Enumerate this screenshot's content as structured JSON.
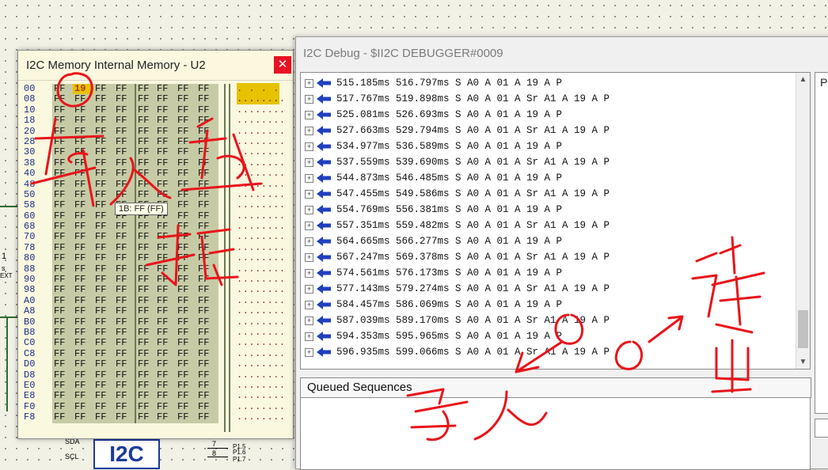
{
  "schematic": {
    "logo": "I2C",
    "pins": [
      {
        "num": "7",
        "label": "P1.5"
      },
      {
        "num": "8",
        "label": "P1.6"
      },
      {
        "num": "",
        "label": "P1.7"
      }
    ],
    "net_labels": [
      "SDA",
      "SCL"
    ],
    "left_labels": [
      "1",
      "s",
      "EXT"
    ],
    "wire_color": "#2f6b2f"
  },
  "memory_window": {
    "title": "I2C Memory Internal Memory - U2",
    "close_glyph": "✕",
    "addresses": [
      "00",
      "08",
      "10",
      "18",
      "20",
      "28",
      "30",
      "38",
      "40",
      "48",
      "50",
      "58",
      "60",
      "68",
      "70",
      "78",
      "80",
      "88",
      "90",
      "98",
      "A0",
      "A8",
      "B0",
      "B8",
      "C0",
      "C8",
      "D0",
      "D8",
      "E0",
      "E8",
      "F0",
      "F8"
    ],
    "fill_byte": "FF",
    "first_row": [
      "FF",
      "19",
      "FF",
      "FF",
      "FF",
      "FF",
      "FF",
      "FF"
    ],
    "highlight_value": "19",
    "ascii_first_row": ". . . . . . . .",
    "ascii_row": "........",
    "tooltip": "1B: FF (FF)"
  },
  "debug_window": {
    "title": "I2C Debug - $II2C DEBUGGER#0009",
    "expander_glyph": "+",
    "rows": [
      "515.185ms 516.797ms S A0 A 01 A 19 A P",
      "517.767ms 519.898ms S A0 A 01 A Sr A1 A 19 A P",
      "525.081ms 526.693ms S A0 A 01 A 19 A P",
      "527.663ms 529.794ms S A0 A 01 A Sr A1 A 19 A P",
      "534.977ms 536.589ms S A0 A 01 A 19 A P",
      "537.559ms 539.690ms S A0 A 01 A Sr A1 A 19 A P",
      "544.873ms 546.485ms S A0 A 01 A 19 A P",
      "547.455ms 549.586ms S A0 A 01 A Sr A1 A 19 A P",
      "554.769ms 556.381ms S A0 A 01 A 19 A P",
      "557.351ms 559.482ms S A0 A 01 A Sr A1 A 19 A P",
      "564.665ms 566.277ms S A0 A 01 A 19 A P",
      "567.247ms 569.378ms S A0 A 01 A Sr A1 A 19 A P",
      "574.561ms 576.173ms S A0 A 01 A 19 A P",
      "577.143ms 579.274ms S A0 A 01 A Sr A1 A 19 A P",
      "584.457ms 586.069ms S A0 A 01 A 19 A P",
      "587.039ms 589.170ms S A0 A 01 A Sr A1 A 19 A P",
      "594.353ms 595.965ms S A0 A 01 A 19 A P",
      "596.935ms 599.066ms S A0 A 01 A Sr A1 A 19 A P"
    ],
    "queued_label": "Queued Sequences",
    "side_letter": "P",
    "arrow_color": "#1f3fbf"
  },
  "annotations": {
    "ink_color": "#e8141a",
    "store_data": "存入数据",
    "write": "写入",
    "read_out": "读出"
  }
}
